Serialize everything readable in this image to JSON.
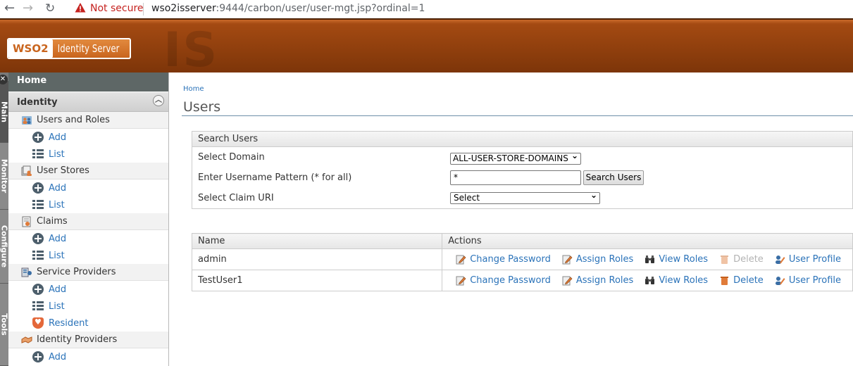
{
  "browser": {
    "security_label": "Not secure",
    "url_host": "wso2isserver",
    "url_rest": ":9444/carbon/user/user-mgt.jsp?ordinal=1"
  },
  "header": {
    "logo_mark": "WSO2",
    "product_name": "Identity Server",
    "watermark": "IS"
  },
  "vertical_tabs": [
    "Main",
    "Monitor",
    "Configure",
    "Tools"
  ],
  "sidebar": {
    "home": "Home",
    "section": "Identity",
    "groups": [
      {
        "label": "Users and Roles",
        "items": [
          "Add",
          "List"
        ]
      },
      {
        "label": "User Stores",
        "items": [
          "Add",
          "List"
        ]
      },
      {
        "label": "Claims",
        "items": [
          "Add",
          "List"
        ]
      },
      {
        "label": "Service Providers",
        "items": [
          "Add",
          "List",
          "Resident"
        ]
      },
      {
        "label": "Identity Providers",
        "items": [
          "Add"
        ]
      }
    ]
  },
  "main": {
    "breadcrumb": "Home",
    "title": "Users",
    "search": {
      "heading": "Search Users",
      "domain_label": "Select Domain",
      "domain_value": "ALL-USER-STORE-DOMAINS",
      "pattern_label": "Enter Username Pattern (* for all)",
      "pattern_value": "*",
      "search_button": "Search Users",
      "claim_label": "Select Claim URI",
      "claim_value": "Select"
    },
    "table": {
      "headers": [
        "Name",
        "Actions"
      ],
      "rows": [
        {
          "name": "admin",
          "actions": [
            "Change Password",
            "Assign Roles",
            "View Roles",
            "Delete",
            "User Profile"
          ],
          "delete_enabled": false
        },
        {
          "name": "TestUser1",
          "actions": [
            "Change Password",
            "Assign Roles",
            "View Roles",
            "Delete",
            "User Profile"
          ],
          "delete_enabled": true
        }
      ]
    }
  },
  "colors": {
    "header_brown": "#7d3509",
    "link_blue": "#2b73b9",
    "disabled_gray": "#b3b3b3",
    "sidebar_dark": "#5e6766"
  }
}
